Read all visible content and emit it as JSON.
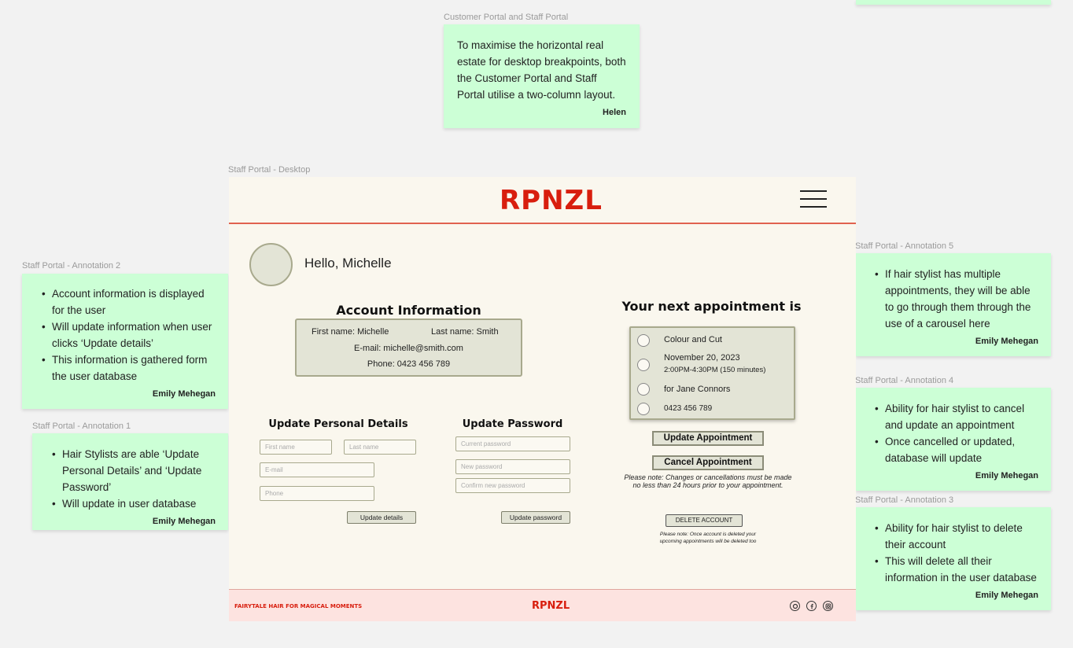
{
  "labels": {
    "customer_staff": "Customer Portal and Staff Portal",
    "staff_desktop": "Staff Portal - Desktop",
    "annotation2": "Staff Portal - Annotation 2",
    "annotation1": "Staff Portal - Annotation 1",
    "annotation5": "Staff Portal - Annotation 5",
    "annotation4": "Staff Portal - Annotation 4",
    "annotation3": "Staff Portal - Annotation 3"
  },
  "notes": {
    "top": {
      "text": "To maximise the horizontal real estate for desktop breakpoints, both the Customer Portal and Staff Portal utilise a two-column layout.",
      "author": "Helen"
    },
    "annotation2": {
      "items": [
        "Account information is displayed for the user",
        "Will update information when user clicks ‘Update details’",
        "This information is gathered form the user database"
      ],
      "author": "Emily Mehegan"
    },
    "annotation1": {
      "items": [
        "Hair Stylists are able ‘Update Personal Details’ and ‘Update Password’",
        "Will update in user database"
      ],
      "author": "Emily Mehegan"
    },
    "annotation5": {
      "items": [
        "If hair stylist has multiple appointments, they will be able to go through them through the use of a carousel here"
      ],
      "author": "Emily Mehegan"
    },
    "annotation4": {
      "items": [
        "Ability for hair stylist to cancel and update an appointment",
        "Once cancelled or updated, database will update"
      ],
      "author": "Emily Mehegan"
    },
    "annotation3": {
      "items": [
        "Ability for hair stylist to delete their account",
        "This will delete all their information in the user database"
      ],
      "author": "Emily Mehegan"
    }
  },
  "portal": {
    "logo": "RPNZL",
    "greeting": "Hello, Michelle",
    "account_title": "Account Information",
    "account": {
      "first_name": "First name: Michelle",
      "last_name": "Last name: Smith",
      "email": "E-mail: michelle@smith.com",
      "phone": "Phone: 0423 456 789"
    },
    "personal_title": "Update Personal Details",
    "password_title": "Update Password",
    "placeholders": {
      "first_name": "First name",
      "last_name": "Last name",
      "email": "E-mail",
      "phone": "Phone",
      "current_password": "Current password",
      "new_password": "New password",
      "confirm_password": "Confirm new password"
    },
    "update_details": "Update details",
    "update_password": "Update password",
    "appointment_title": "Your next appointment is",
    "appointment": {
      "service": "Colour and Cut",
      "date": "November 20, 2023",
      "time": "2:00PM-4:30PM (150 minutes)",
      "client": "for Jane Connors",
      "phone": "0423 456 789"
    },
    "update_appointment": "Update Appointment",
    "cancel_appointment": "Cancel Appointment",
    "cancel_note_1": "Please note: Changes or cancellations must be made",
    "cancel_note_2": "no less than 24 hours prior to your appointment.",
    "delete_account": "DELETE ACCOUNT",
    "delete_note_1": "Please note: Once account is deleted your",
    "delete_note_2": "upcoming appointments will be deleted too",
    "footer_tagline": "FAIRYTALE HAIR FOR MAGICAL MOMENTS",
    "footer_logo": "RPNZL"
  },
  "colors": {
    "brand": "#d81e0e",
    "sticky": "#ccffd6",
    "panel": "#e3e4d6"
  }
}
